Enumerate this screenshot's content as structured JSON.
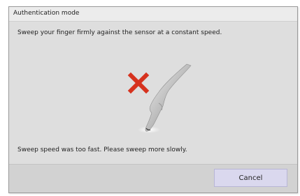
{
  "dialog": {
    "title": "Authentication mode",
    "instruction": "Sweep your finger firmly against the sensor at a constant speed.",
    "status_message": "Sweep speed was too fast. Please sweep more slowly.",
    "cancel_label": "Cancel"
  },
  "illustration": {
    "error_mark_icon": "red-x-icon",
    "finger_icon": "finger-sweep-icon",
    "error_color": "#d6321e"
  }
}
